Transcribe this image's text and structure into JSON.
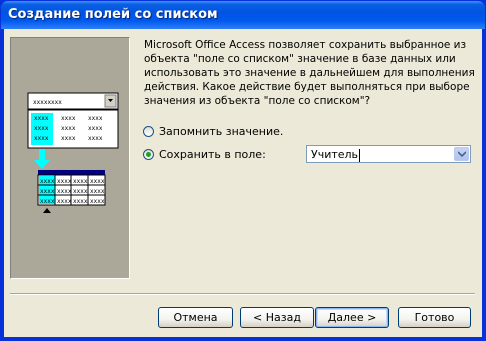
{
  "window": {
    "title": "Создание полей со списком"
  },
  "description": {
    "lines": [
      "Microsoft Office Access позволяет сохранить выбранное из",
      "объекта \"поле со списком\" значение в базе данных или",
      "использовать это значение в дальнейшем для выполнения",
      "действия.  Какое действие будет выполняться при выборе",
      "значения из объекта \"поле со списком\"?"
    ]
  },
  "options": {
    "remember": {
      "label": "Запомнить значение.",
      "selected": false
    },
    "store": {
      "label": "Сохранить в поле:",
      "selected": true
    }
  },
  "field_select": {
    "value": "Учитель"
  },
  "buttons": {
    "cancel": "Отмена",
    "back": "< Назад",
    "next": "Далее >",
    "finish": "Готово"
  },
  "illustration": {
    "combo_text": "xxxxxxxx",
    "cell_text": "xxxx",
    "accent_color": "#00ffff"
  }
}
